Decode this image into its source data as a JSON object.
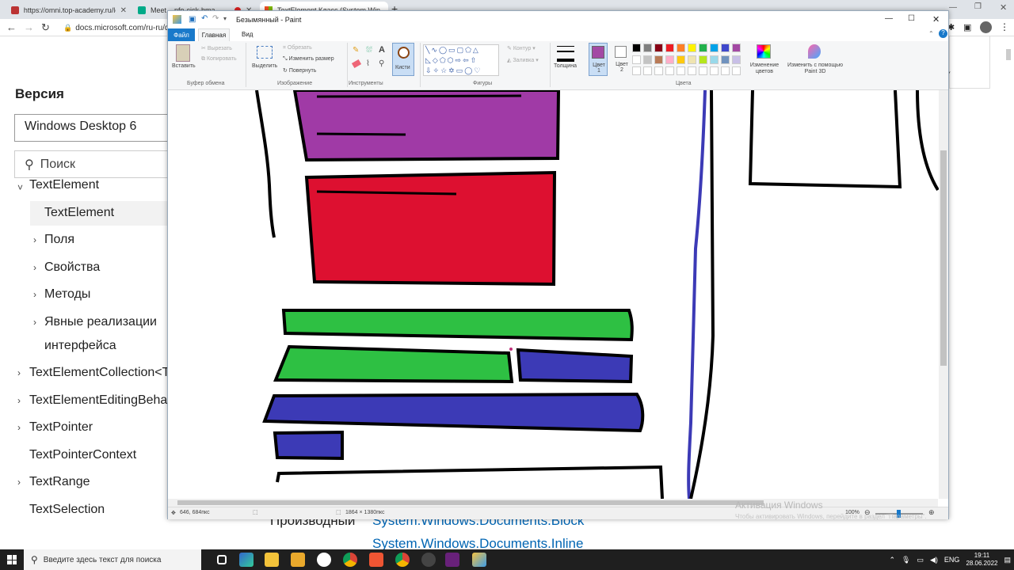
{
  "browser": {
    "tabs": [
      {
        "label": "https://omni.top-academy.ru/lo"
      },
      {
        "label": "Meet – pfo-cick-bma"
      },
      {
        "label": "TextElement Класс (System.Wind"
      }
    ],
    "new_tab": "+",
    "url": "docs.microsoft.com/ru-ru/do"
  },
  "docs": {
    "version_heading": "Версия",
    "version_value": "Windows Desktop 6",
    "search_placeholder": "Поиск",
    "tree": [
      {
        "label": "TextElement",
        "chev": "˅"
      },
      {
        "label": "TextElement",
        "chev": ""
      },
      {
        "label": "Поля",
        "chev": "›"
      },
      {
        "label": "Свойства",
        "chev": "›"
      },
      {
        "label": "Методы",
        "chev": "›"
      },
      {
        "label": "Явные реализации",
        "chev": "›"
      },
      {
        "label": "интерфейса",
        "chev": ""
      },
      {
        "label": "TextElementCollection<T",
        "chev": "›"
      },
      {
        "label": "TextElementEditingBeha",
        "chev": "›"
      },
      {
        "label": "TextPointer",
        "chev": "›"
      },
      {
        "label": "TextPointerContext",
        "chev": ""
      },
      {
        "label": "TextRange",
        "chev": "›"
      },
      {
        "label": "TextSelection",
        "chev": ""
      }
    ],
    "derived_label": "Производный",
    "derived_links": [
      "System.Windows.Documents.Block",
      "System.Windows.Documents.Inline"
    ]
  },
  "paint": {
    "title": "Безымянный - Paint",
    "tabs": {
      "file": "Файл",
      "home": "Главная",
      "view": "Вид"
    },
    "ribbon": {
      "paste": "Вставить",
      "cut": "Вырезать",
      "copy": "Копировать",
      "clipboard_group": "Буфер обмена",
      "select": "Выделить",
      "crop": "Обрезать",
      "resize": "Изменить размер",
      "rotate": "Повернуть",
      "image_group": "Изображение",
      "tools_group": "Инструменты",
      "brushes": "Кисти",
      "outline": "Контур",
      "fill": "Заливка",
      "shapes_group": "Фигуры",
      "thickness": "Толщина",
      "color1": "Цвет 1",
      "color2": "Цвет 2",
      "edit_colors": "Изменение цветов",
      "paint3d": "Изменить с помощью Paint 3D",
      "colors_group": "Цвета"
    },
    "palette": [
      "#000000",
      "#7f7f7f",
      "#880015",
      "#ed1c24",
      "#ff7f27",
      "#fff200",
      "#22b14c",
      "#00a2e8",
      "#3f48cc",
      "#a349a4",
      "#ffffff",
      "#c3c3c3",
      "#b97a57",
      "#ffaec9",
      "#ffc90e",
      "#efe4b0",
      "#b5e61d",
      "#99d9ea",
      "#7092be",
      "#c8bfe7"
    ],
    "color1_value": "#a349a4",
    "status": {
      "cursor": "646, 684пкс",
      "size": "1864 × 1380пкс",
      "zoom": "100%"
    }
  },
  "watermark": {
    "title": "Активация Windows",
    "subtitle": "Чтобы активировать Windows, перейдите в раздел \"Параметры\"."
  },
  "taskbar": {
    "search_placeholder": "Введите здесь текст для поиска",
    "lang": "ENG",
    "time": "19:11",
    "date": "28.06.2022"
  }
}
